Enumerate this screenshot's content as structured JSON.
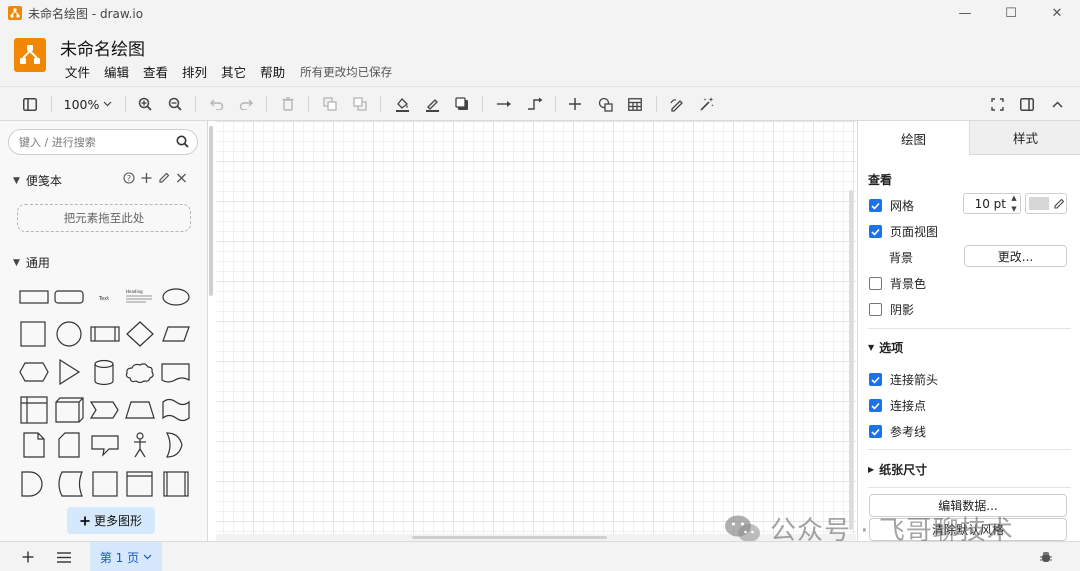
{
  "window": {
    "title": "未命名绘图 - draw.io",
    "minimize": "—",
    "maximize": "☐",
    "close": "✕"
  },
  "header": {
    "doc_title": "未命名绘图",
    "menu": [
      "文件",
      "编辑",
      "查看",
      "排列",
      "其它",
      "帮助"
    ],
    "saved_status": "所有更改均已保存"
  },
  "toolbar": {
    "zoom": "100%"
  },
  "sidebar": {
    "search_placeholder": "键入 / 进行搜索",
    "scratchpad_title": "便笺本",
    "scratchpad_drop": "把元素拖至此处",
    "general_title": "通用",
    "more_shapes": "更多图形",
    "shape_text": "Text",
    "shape_heading": "Heading"
  },
  "format_panel": {
    "tabs": [
      "绘图",
      "样式"
    ],
    "view_title": "查看",
    "grid_label": "网格",
    "grid_checked": true,
    "grid_size": "10 pt",
    "page_view_label": "页面视图",
    "page_view_checked": true,
    "background_label": "背景",
    "change_button": "更改...",
    "bg_color_label": "背景色",
    "bg_color_checked": false,
    "shadow_label": "阴影",
    "shadow_checked": false,
    "options_title": "选项",
    "connection_arrows_label": "连接箭头",
    "connection_arrows_checked": true,
    "connection_points_label": "连接点",
    "connection_points_checked": true,
    "guides_label": "参考线",
    "guides_checked": true,
    "paper_size_title": "纸张尺寸",
    "edit_data_button": "编辑数据...",
    "clear_style_button": "清除默认风格"
  },
  "bottom": {
    "page_tab": "第 1 页"
  },
  "watermark": {
    "text": "公众号 · 飞哥聊技术"
  },
  "colors": {
    "accent": "#1a73e8",
    "brand": "#f08705",
    "page_tab_bg": "#d6e8fb"
  }
}
